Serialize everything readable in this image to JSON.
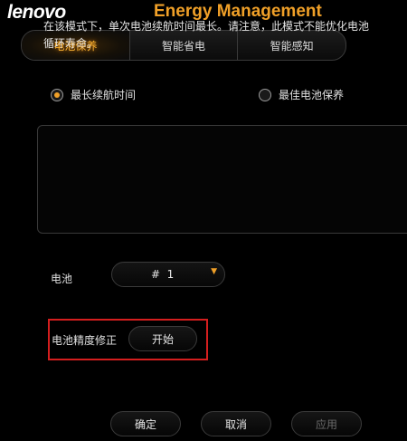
{
  "titlebar": {
    "logo": "lenovo",
    "title": "Energy Management"
  },
  "tabs": [
    {
      "label": "电池保养",
      "active": true
    },
    {
      "label": "智能省电",
      "active": false
    },
    {
      "label": "智能感知",
      "active": false
    }
  ],
  "mode": {
    "options": [
      {
        "label": "最长续航时间",
        "checked": true
      },
      {
        "label": "最佳电池保养",
        "checked": false
      }
    ]
  },
  "description": "在该模式下，单次电池续航时间最长。请注意，此模式不能优化电池循环寿命。",
  "battery": {
    "label": "电池",
    "selected": "#  1"
  },
  "calibration": {
    "label": "电池精度修正",
    "button": "开始"
  },
  "footer": {
    "ok": "确定",
    "cancel": "取消",
    "apply": "应用"
  },
  "colors": {
    "accent": "#f0a028",
    "highlight_frame": "#d41e1e",
    "background": "#000000"
  }
}
